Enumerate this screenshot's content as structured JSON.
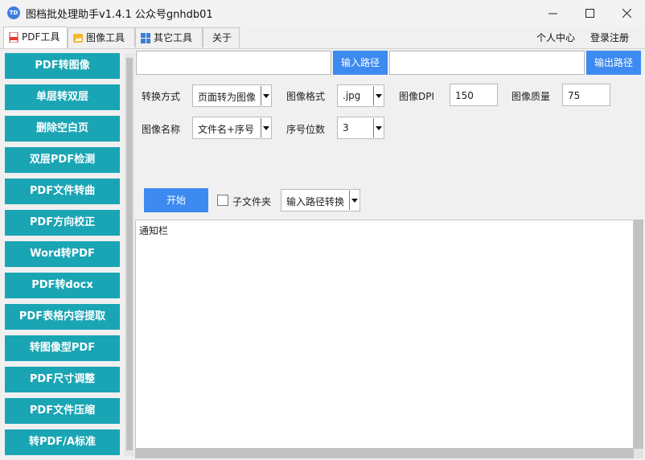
{
  "window": {
    "title": "图档批处理助手v1.4.1 公众号gnhdb01",
    "icon_text": "TD"
  },
  "tabs": [
    {
      "label": "PDF工具",
      "icon": "pdf-icon"
    },
    {
      "label": "图像工具",
      "icon": "image-icon"
    },
    {
      "label": "其它工具",
      "icon": "grid-icon"
    },
    {
      "label": "关于",
      "icon": ""
    }
  ],
  "top_links": {
    "user_center": "个人中心",
    "login": "登录注册"
  },
  "sidebar": {
    "color": "#1aa5b4",
    "items": [
      "PDF转图像",
      "单层转双层",
      "删除空白页",
      "双层PDF检测",
      "PDF文件转曲",
      "PDF方向校正",
      "Word转PDF",
      "PDF转docx",
      "PDF表格内容提取",
      "转图像型PDF",
      "PDF尺寸调整",
      "PDF文件压缩",
      "转PDF/A标准"
    ]
  },
  "paths": {
    "input_button": "输入路径",
    "output_button": "输出路径",
    "input_value": "",
    "output_value": ""
  },
  "options": {
    "convert_mode_label": "转换方式",
    "convert_mode_value": "页面转为图像",
    "image_format_label": "图像格式",
    "image_format_value": ".jpg",
    "dpi_label": "图像DPI",
    "dpi_value": "150",
    "quality_label": "图像质量",
    "quality_value": "75",
    "image_name_label": "图像名称",
    "image_name_value": "文件名+序号",
    "digits_label": "序号位数",
    "digits_value": "3"
  },
  "actions": {
    "start_button": "开始",
    "subfolder_label": "子文件夹",
    "subfolder_checked": false,
    "path_mode_value": "输入路径转换"
  },
  "notify": {
    "label": "通知栏"
  },
  "colors": {
    "accent": "#3d8af0",
    "sidebar": "#1aa5b4"
  }
}
